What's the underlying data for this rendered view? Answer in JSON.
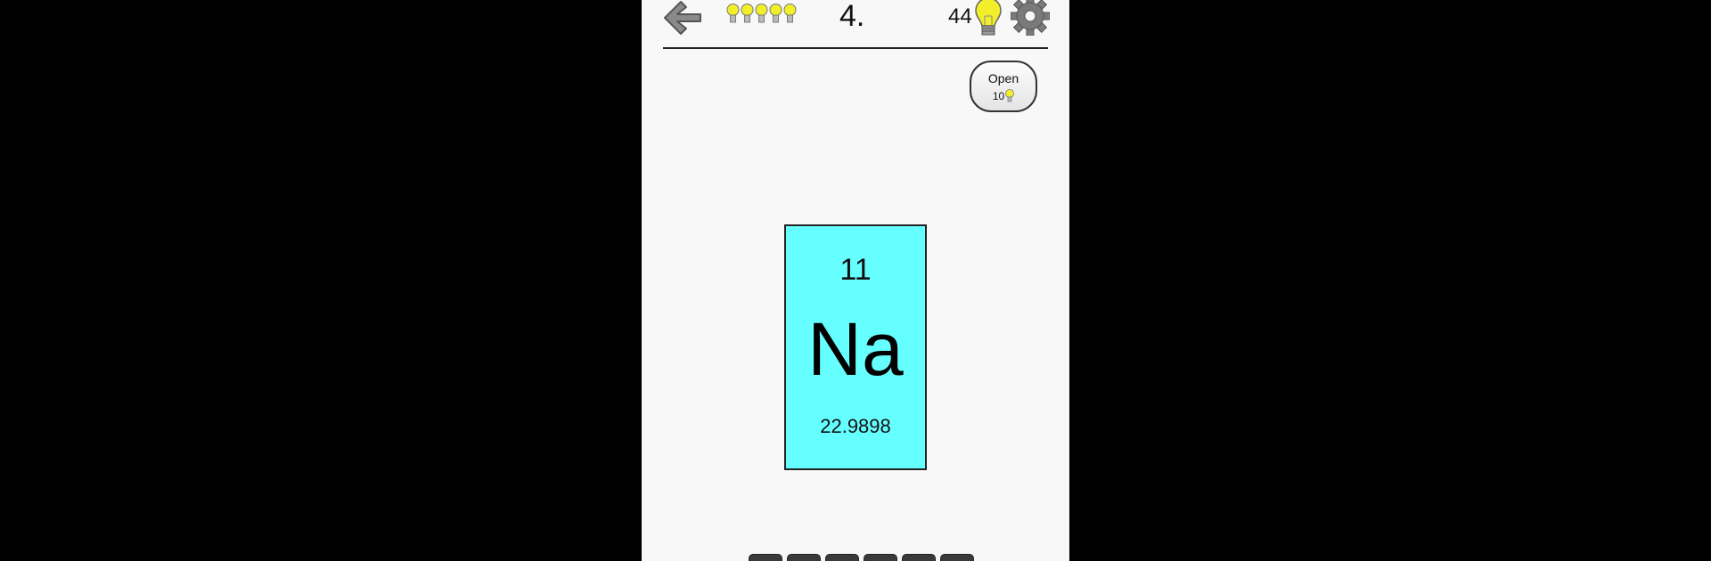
{
  "header": {
    "level": "4.",
    "hints_count": "44",
    "lives_count": 5,
    "colors": {
      "bulb": "#f2ef2a",
      "icon_gray": "#7a7a7a"
    },
    "icons": [
      "back-arrow-icon",
      "bulb-icon",
      "gear-icon"
    ]
  },
  "open_button": {
    "label": "Open",
    "cost": "10"
  },
  "element": {
    "atomic_number": "11",
    "symbol": "Na",
    "atomic_mass": "22.9898",
    "card_color": "#66ffff"
  },
  "answer": {
    "slot_count": 6
  }
}
